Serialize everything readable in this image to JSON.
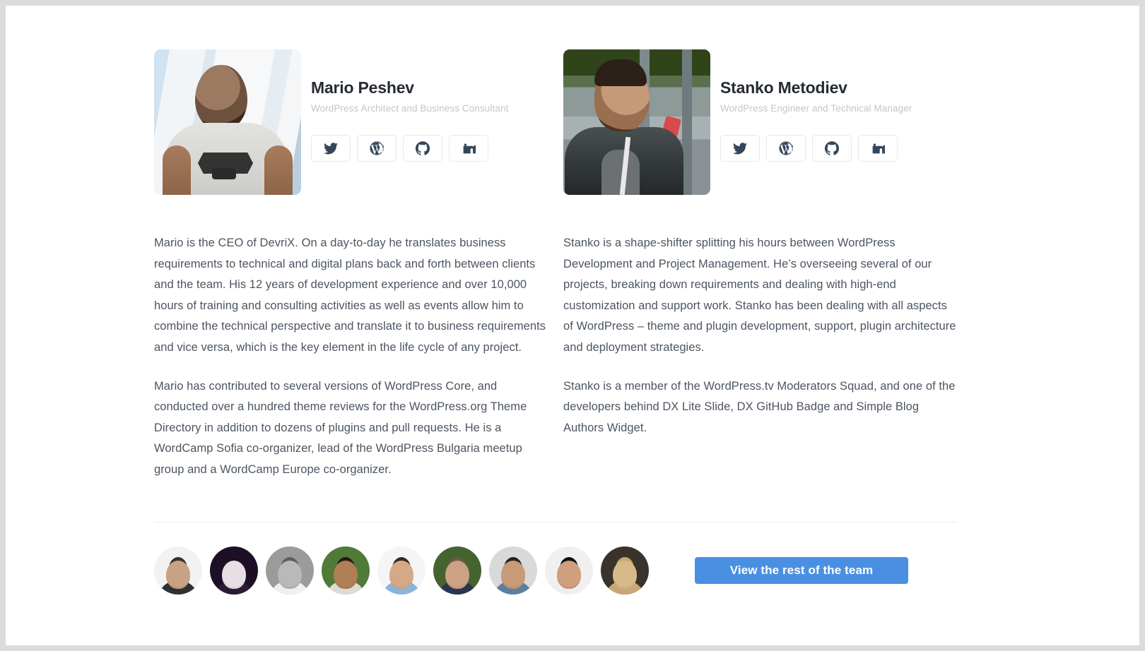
{
  "theme": {
    "page_background": "#ffffff",
    "outer_background": "#dcdcdc",
    "text_primary": "#262b33",
    "text_body": "#4c5561",
    "text_muted": "#c2c6cb",
    "accent": "#4a90e2",
    "divider": "#e9ebec",
    "icon_color": "#33475b"
  },
  "profiles": [
    {
      "name": "Mario Peshev",
      "role": "WordPress Architect and Business Consultant",
      "photo_alt": "Mario Peshev portrait",
      "socials": [
        {
          "icon": "twitter-icon",
          "label": "Twitter"
        },
        {
          "icon": "wordpress-icon",
          "label": "WordPress"
        },
        {
          "icon": "github-icon",
          "label": "GitHub"
        },
        {
          "icon": "linkedin-icon",
          "label": "LinkedIn"
        }
      ],
      "bio": [
        "Mario is the CEO of DevriX. On a day-to-day he translates business requirements to technical and digital plans back and forth between clients and the team. His 12 years of development experience and over 10,000 hours of training and consulting activities as well as events allow him to combine the technical perspective and translate it to business requirements and vice versa, which is the key element in the life cycle of any project.",
        "Mario has contributed to several versions of WordPress Core, and conducted over a hundred theme reviews for the WordPress.org Theme Directory in addition to dozens of plugins and pull requests. He is a WordCamp Sofia co-organizer, lead of the WordPress Bulgaria meetup group and a WordCamp Europe co-organizer."
      ]
    },
    {
      "name": "Stanko Metodiev",
      "role": "WordPress Engineer and Technical Manager",
      "photo_alt": "Stanko Metodiev portrait",
      "socials": [
        {
          "icon": "twitter-icon",
          "label": "Twitter"
        },
        {
          "icon": "wordpress-icon",
          "label": "WordPress"
        },
        {
          "icon": "github-icon",
          "label": "GitHub"
        },
        {
          "icon": "linkedin-icon",
          "label": "LinkedIn"
        }
      ],
      "bio": [
        "Stanko is a shape-shifter splitting his hours between WordPress Development and Project Management. He’s overseeing several of our projects, breaking down requirements and dealing with high-end customization and support work. Stanko has been dealing with all aspects of WordPress – theme and plugin development, support, plugin architecture and deployment strategies.",
        "Stanko is a member of the WordPress.tv Moderators Squad, and one of the developers behind DX Lite Slide, DX GitHub Badge and Simple Blog Authors Widget."
      ]
    }
  ],
  "team_strip": {
    "avatars": [
      {
        "name": "team-member-1",
        "skin": "#c9a184",
        "hair": "#3a3029",
        "bg": "#f2f2f2",
        "body": "#2f3033"
      },
      {
        "name": "team-member-2",
        "skin": "#e8dfe4",
        "hair": "#1b1020",
        "bg": "#1d1026",
        "body": "#2a1a33"
      },
      {
        "name": "team-member-3",
        "skin": "#b9b9b9",
        "hair": "#5d5d5d",
        "bg": "#9b9b9b",
        "body": "#f0f0f0"
      },
      {
        "name": "team-member-4",
        "skin": "#b07f55",
        "hair": "#241a14",
        "bg": "#4f7a38",
        "body": "#dcdcd6"
      },
      {
        "name": "team-member-5",
        "skin": "#d6a986",
        "hair": "#3b2b1f",
        "bg": "#f4f5f6",
        "body": "#8bb4dd"
      },
      {
        "name": "team-member-6",
        "skin": "#cda184",
        "hair": "#6b5a44",
        "bg": "#45632f",
        "body": "#2a3550"
      },
      {
        "name": "team-member-7",
        "skin": "#c79a78",
        "hair": "#2c2119",
        "bg": "#d8d9db",
        "body": "#5d7f9b"
      },
      {
        "name": "team-member-8",
        "skin": "#cf9f7e",
        "hair": "#120c0c",
        "bg": "#f0f0f1",
        "body": "#efefef"
      },
      {
        "name": "team-dog",
        "skin": "#d8b98a",
        "hair": "#c9a86f",
        "bg": "#3a332c",
        "body": "#c8a676"
      }
    ],
    "cta_label": "View the rest of the team"
  }
}
